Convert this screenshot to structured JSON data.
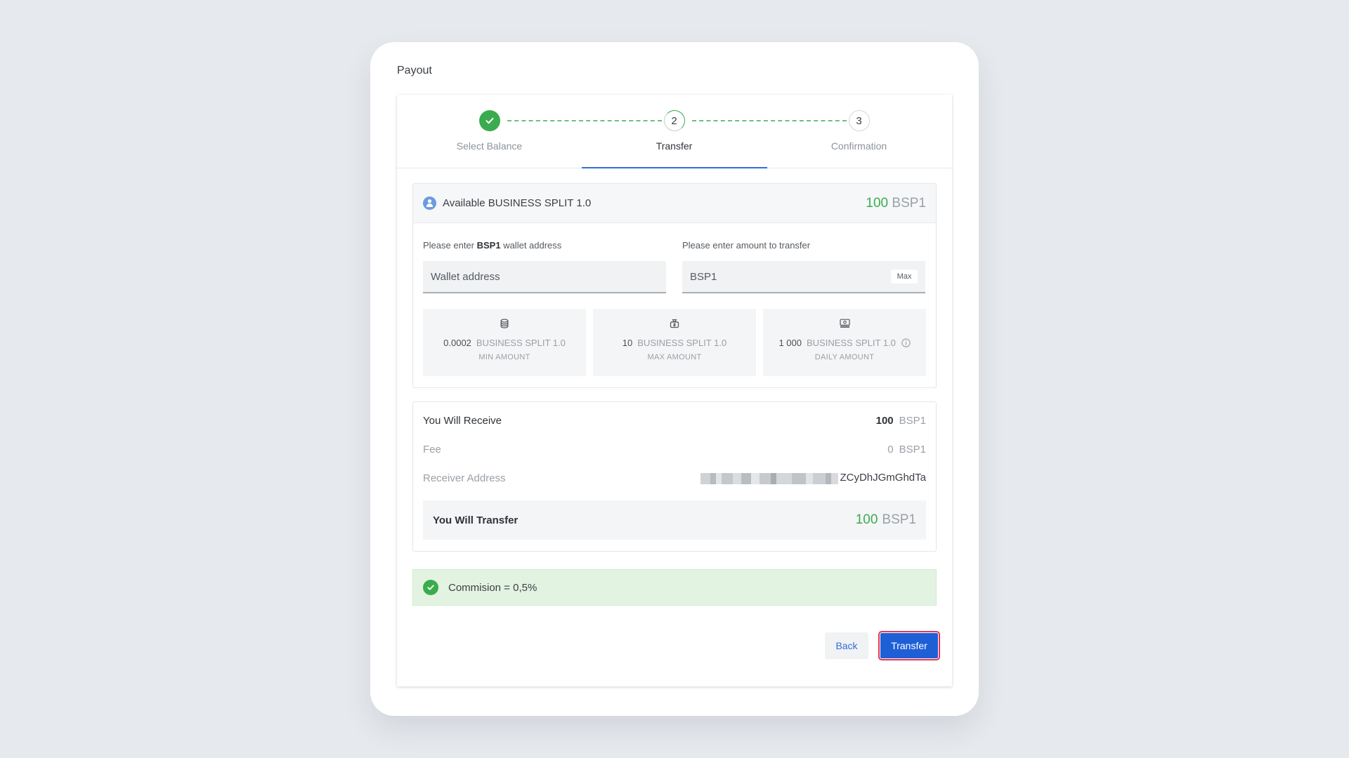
{
  "page_title": "Payout",
  "stepper": {
    "steps": [
      {
        "label": "Select Balance",
        "number": "1",
        "state": "done"
      },
      {
        "label": "Transfer",
        "number": "2",
        "state": "active"
      },
      {
        "label": "Confirmation",
        "number": "3",
        "state": "todo"
      }
    ]
  },
  "available": {
    "title": "Available BUSINESS SPLIT 1.0",
    "amount": "100",
    "currency": "BSP1"
  },
  "wallet_field": {
    "label_prefix": "Please enter ",
    "label_bold": "BSP1",
    "label_suffix": " wallet address",
    "placeholder": "Wallet address",
    "value": ""
  },
  "amount_field": {
    "label": "Please enter amount to transfer",
    "placeholder": "BSP1",
    "value": "",
    "max_label": "Max"
  },
  "limits": [
    {
      "icon": "database-icon",
      "amount": "0.0002",
      "unit": "BUSINESS SPLIT 1.0",
      "caption": "MIN AMOUNT"
    },
    {
      "icon": "money-bag-icon",
      "amount": "10",
      "unit": "BUSINESS SPLIT 1.0",
      "caption": "MAX AMOUNT"
    },
    {
      "icon": "cash-stack-icon",
      "amount": "1 000",
      "unit": "BUSINESS SPLIT 1.0",
      "caption": "DAILY AMOUNT"
    }
  ],
  "summary": {
    "receive_label": "You Will Receive",
    "receive_amount": "100",
    "receive_currency": "BSP1",
    "fee_label": "Fee",
    "fee_amount": "0",
    "fee_currency": "BSP1",
    "address_label": "Receiver Address",
    "address_visible": "ZCyDhJGmGhdTa",
    "transfer_label": "You Will Transfer",
    "transfer_amount": "100",
    "transfer_currency": "BSP1"
  },
  "commission": {
    "text": "Commision = 0,5%"
  },
  "buttons": {
    "back": "Back",
    "transfer": "Transfer"
  },
  "colors": {
    "accent": "#1f5fd6",
    "success": "#3aac4f",
    "highlight": "#e23552"
  }
}
